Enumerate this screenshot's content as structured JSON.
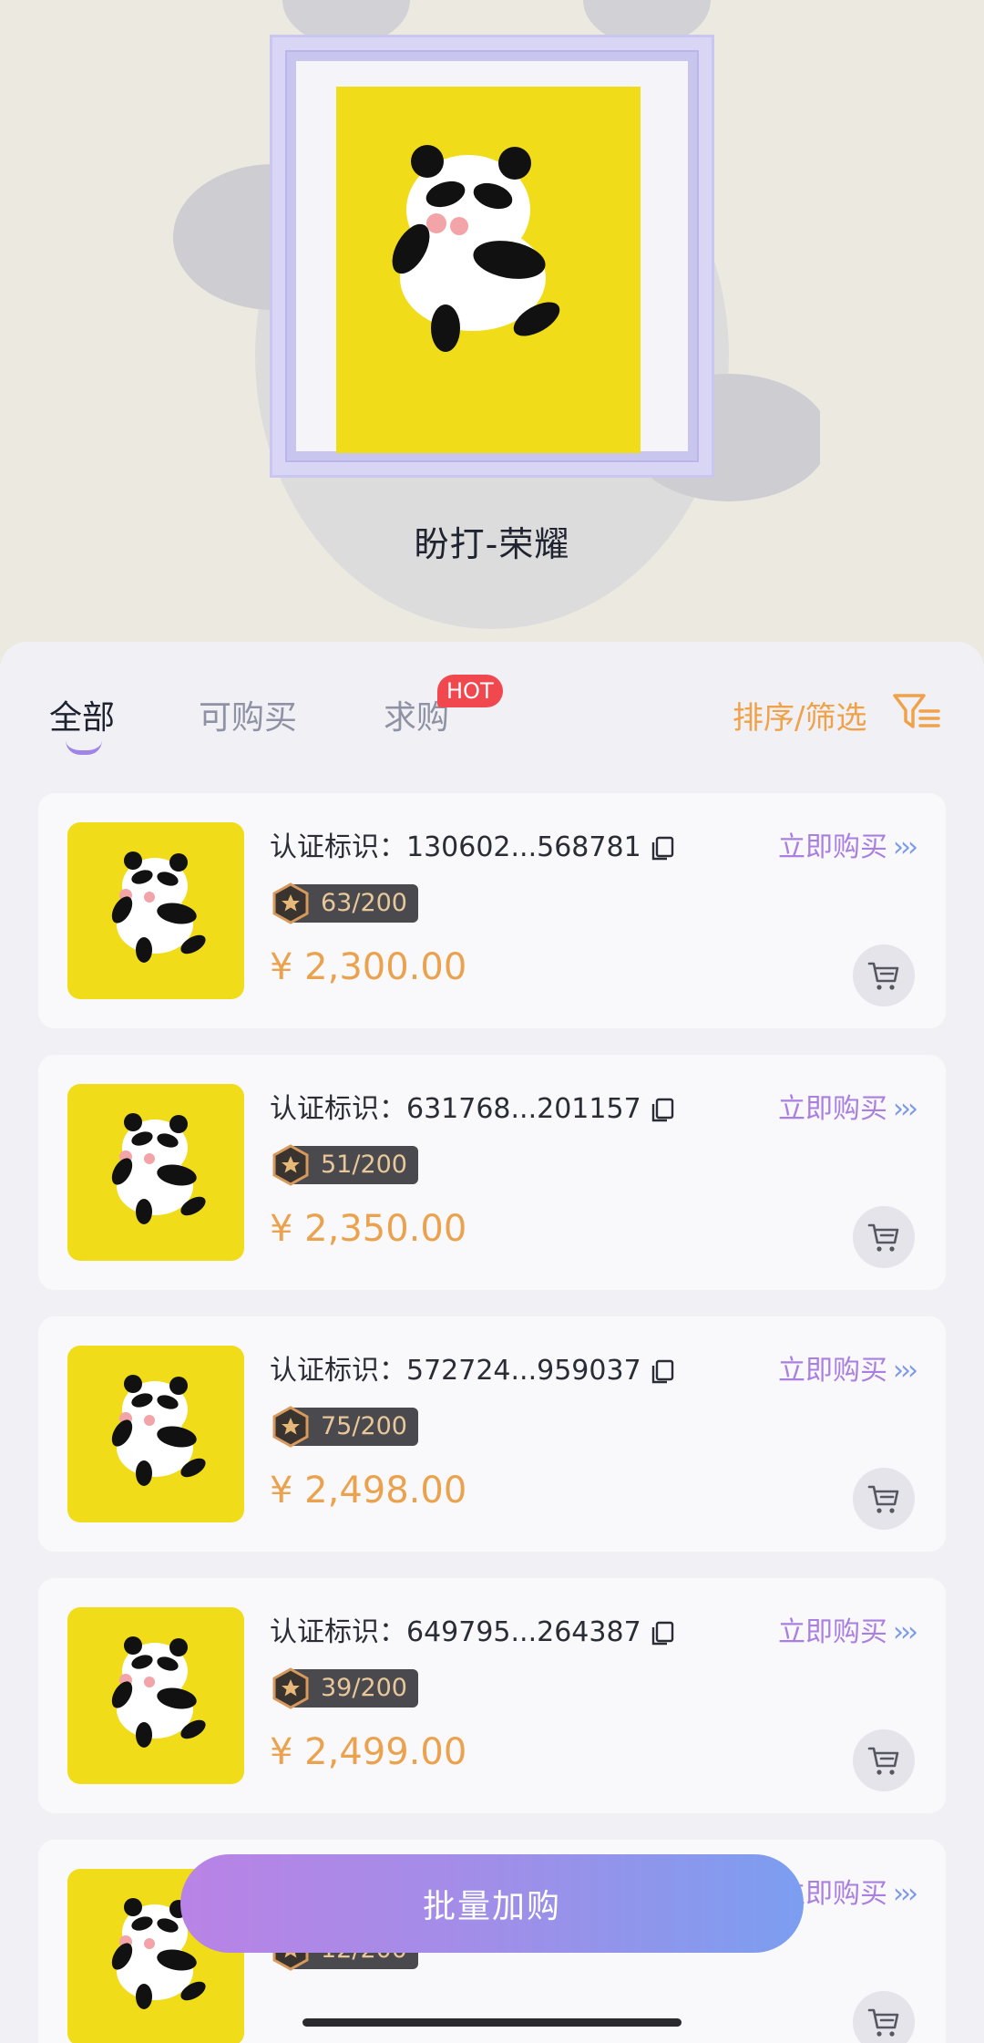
{
  "collection": {
    "title": "盼打-荣耀"
  },
  "tabs": [
    {
      "label": "全部",
      "active": true
    },
    {
      "label": "可购买",
      "active": false
    },
    {
      "label": "求购",
      "active": false,
      "badge": "HOT"
    }
  ],
  "sort_filter_label": "排序/筛选",
  "cert_prefix": "认证标识：",
  "buy_now_label": "立即购买",
  "items": [
    {
      "cert_id": "130602...568781",
      "edition": "63/200",
      "price": "¥ 2,300.00"
    },
    {
      "cert_id": "631768...201157",
      "edition": "51/200",
      "price": "¥ 2,350.00"
    },
    {
      "cert_id": "572724...959037",
      "edition": "75/200",
      "price": "¥ 2,498.00"
    },
    {
      "cert_id": "649795...264387",
      "edition": "39/200",
      "price": "¥ 2,499.00"
    },
    {
      "cert_id": "",
      "edition": "12/200",
      "price": ""
    }
  ],
  "batch_button_label": "批量加购",
  "colors": {
    "accent_orange": "#eba24e",
    "accent_purple": "#a97fe0",
    "accent_blue": "#7c9ae8",
    "art_yellow": "#f0dc18",
    "hot_red": "#f0484e"
  }
}
